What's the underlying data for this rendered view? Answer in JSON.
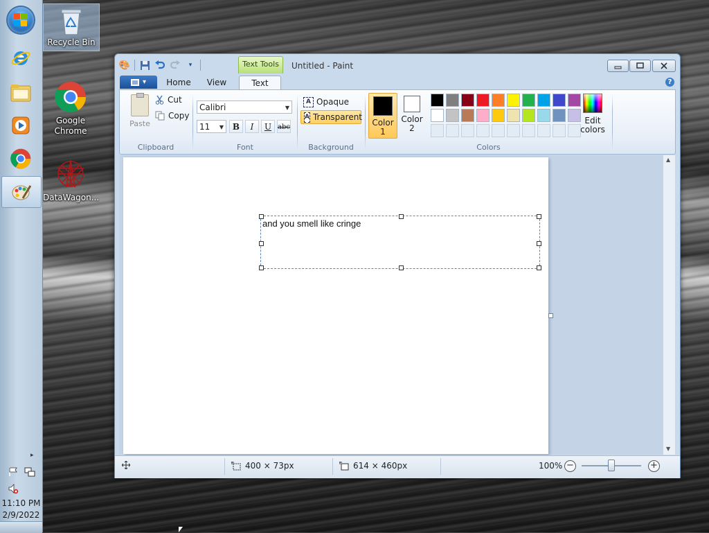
{
  "desktop": {
    "icons": [
      {
        "label": "Recycle Bin"
      },
      {
        "label": "Google Chrome"
      },
      {
        "label": "DataWagon..."
      }
    ]
  },
  "taskbar": {
    "start_icon": "windows-start-orb",
    "pinned": [
      {
        "name": "internet-explorer-icon"
      },
      {
        "name": "file-explorer-icon"
      },
      {
        "name": "media-player-icon"
      },
      {
        "name": "chrome-icon"
      },
      {
        "name": "paint-icon"
      }
    ],
    "tray_chevron": "▸",
    "clock": {
      "time": "11:10 PM",
      "date": "2/9/2022"
    }
  },
  "paint": {
    "window_title": "Untitled - Paint",
    "context_tab": "Text Tools",
    "tabs": {
      "home": "Home",
      "view": "View",
      "text": "Text"
    },
    "clipboard": {
      "paste": "Paste",
      "cut": "Cut",
      "copy": "Copy",
      "group": "Clipboard"
    },
    "font": {
      "family": "Calibri",
      "size": "11",
      "bold": "B",
      "italic": "I",
      "underline": "U",
      "strike": "abc",
      "group": "Font"
    },
    "background": {
      "opaque": "Opaque",
      "transparent": "Transparent",
      "group": "Background"
    },
    "colors": {
      "color1_label": "Color 1",
      "color1_line1": "Color",
      "color1_line2": "1",
      "color2_line1": "Color",
      "color2_line2": "2",
      "edit_line1": "Edit",
      "edit_line2": "colors",
      "group": "Colors",
      "color1": "#000000",
      "color2": "#ffffff",
      "palette_row1": [
        "#000000",
        "#7f7f7f",
        "#880015",
        "#ed1c24",
        "#ff7f27",
        "#fff200",
        "#22b14c",
        "#00a2e8",
        "#3f48cc",
        "#a349a4"
      ],
      "palette_row2": [
        "#ffffff",
        "#c3c3c3",
        "#b97a57",
        "#ffaec9",
        "#ffc90e",
        "#efe4b0",
        "#b5e61d",
        "#99d9ea",
        "#7092be",
        "#c8bfe7"
      ]
    },
    "canvas_text": "and you smell like cringe",
    "status": {
      "selection_size": "400 × 73px",
      "canvas_size": "614 × 460px",
      "zoom": "100%"
    }
  }
}
